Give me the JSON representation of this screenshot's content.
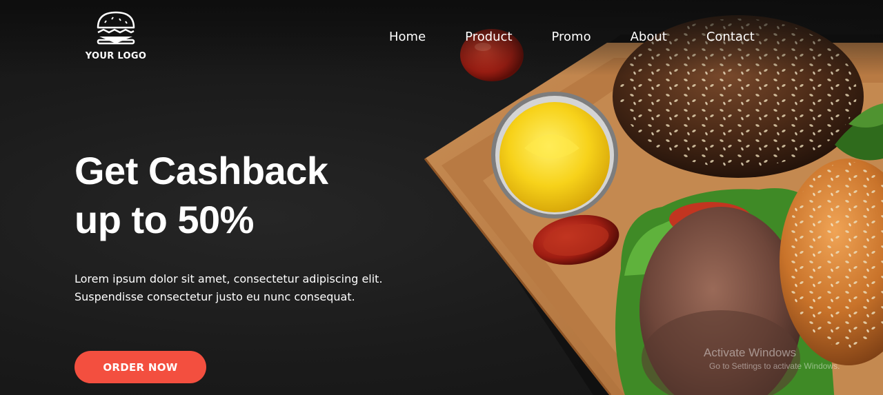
{
  "brand": {
    "logo_text": "YOUR LOGO",
    "logo_icon": "burger-icon"
  },
  "nav": {
    "items": [
      {
        "label": "Home"
      },
      {
        "label": "Product"
      },
      {
        "label": "Promo"
      },
      {
        "label": "About"
      },
      {
        "label": "Contact"
      }
    ]
  },
  "hero": {
    "headline_line1": "Get Cashback",
    "headline_line2": "up to 50%",
    "description": "Lorem ipsum dolor sit amet, consectetur adipiscing elit. Suspendisse consectetur justo eu nunc consequat.",
    "cta_label": "ORDER NOW"
  },
  "watermark": {
    "title": "Activate Windows",
    "subtitle": "Go to Settings to activate Windows."
  },
  "colors": {
    "background": "#161616",
    "accent": "#f34f3f",
    "text": "#ffffff"
  }
}
